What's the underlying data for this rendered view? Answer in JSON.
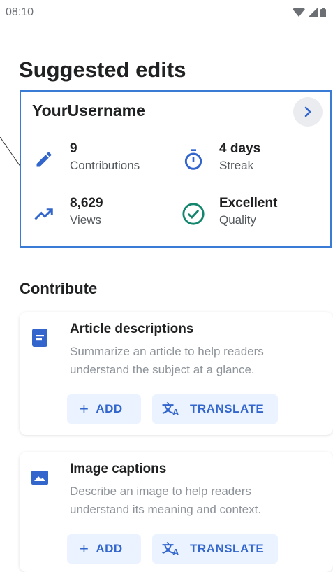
{
  "status_bar": {
    "time": "08:10",
    "icons": [
      "wifi-icon",
      "cellular-icon",
      "battery-icon"
    ]
  },
  "page": {
    "title": "Suggested edits"
  },
  "stats_card": {
    "username": "YourUsername",
    "stats": [
      {
        "value": "9",
        "label": "Contributions",
        "icon": "pencil-icon"
      },
      {
        "value": "4 days",
        "label": "Streak",
        "icon": "stopwatch-icon"
      },
      {
        "value": "8,629",
        "label": "Views",
        "icon": "trending-up-icon"
      },
      {
        "value": "Excellent",
        "label": "Quality",
        "icon": "check-circle-icon"
      }
    ]
  },
  "contribute": {
    "title": "Contribute",
    "tasks": [
      {
        "title": "Article descriptions",
        "description": "Summarize an article to help readers understand the subject at a glance.",
        "add_label": "ADD",
        "translate_label": "TRANSLATE",
        "icon": "document-icon"
      },
      {
        "title": "Image captions",
        "description": "Describe an image to help readers understand its meaning and context.",
        "add_label": "ADD",
        "translate_label": "TRANSLATE",
        "icon": "image-icon"
      }
    ]
  },
  "colors": {
    "accent": "#3366cc",
    "card_border": "#3a7bd5",
    "quality_green": "#14866d",
    "button_bg": "#eaf3ff",
    "muted_text": "#8d9399"
  }
}
